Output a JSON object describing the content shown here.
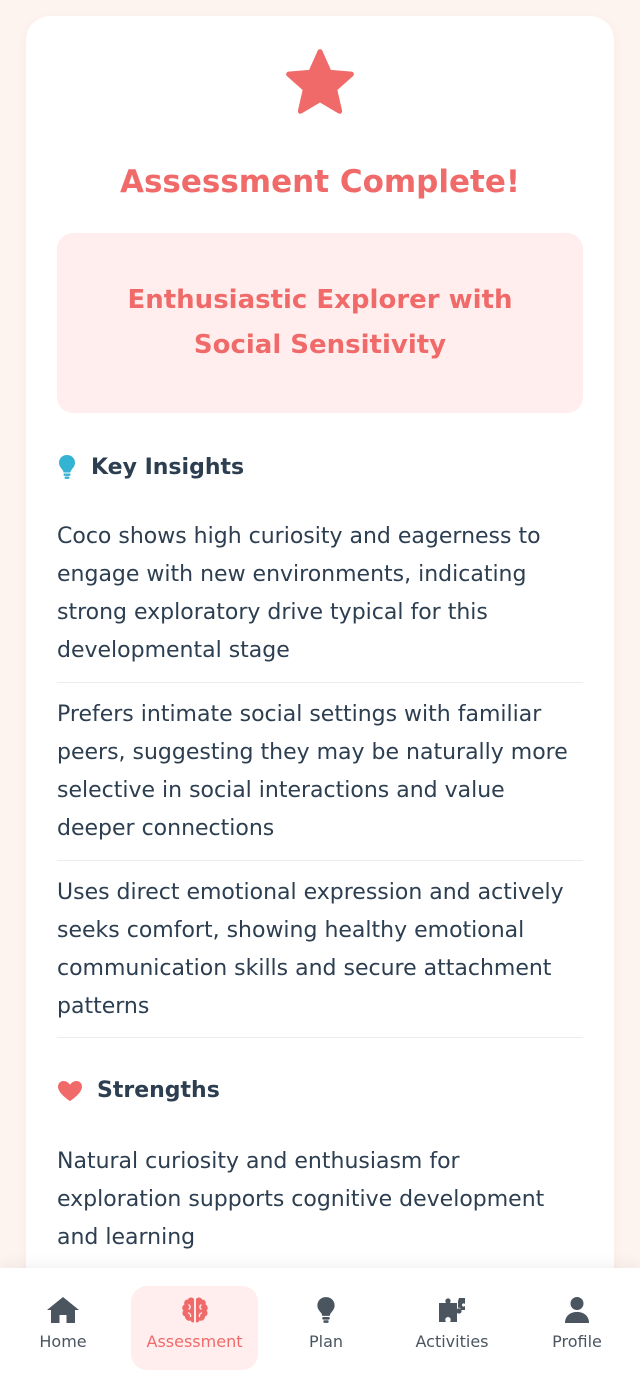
{
  "header": {
    "title": "Assessment Complete!",
    "icon": "star-icon"
  },
  "profile": {
    "type": "Enthusiastic Explorer with Social Sensitivity"
  },
  "key_insights": {
    "heading": "Key Insights",
    "icon": "lightbulb-icon",
    "items": [
      "Coco shows high curiosity and eagerness to engage with new environments, indicating strong exploratory drive typical for this developmental stage",
      "Prefers intimate social settings with familiar peers, suggesting they may be naturally more selective in social interactions and value deeper connections",
      "Uses direct emotional expression and actively seeks comfort, showing healthy emotional communication skills and secure attachment patterns"
    ]
  },
  "strengths": {
    "heading": "Strengths",
    "icon": "heart-icon",
    "items": [
      "Natural curiosity and enthusiasm for exploration supports cognitive development and learning"
    ]
  },
  "nav": {
    "items": [
      {
        "label": "Home",
        "icon": "home-icon"
      },
      {
        "label": "Assessment",
        "icon": "brain-icon"
      },
      {
        "label": "Plan",
        "icon": "lightbulb-icon"
      },
      {
        "label": "Activities",
        "icon": "puzzle-icon"
      },
      {
        "label": "Profile",
        "icon": "user-icon"
      }
    ],
    "active": "Assessment"
  },
  "colors": {
    "accent": "#f06a6a",
    "accent_soft": "#ffeeed",
    "text": "#2c3e50",
    "insight_icon": "#35b3d3",
    "nav_icon": "#4a5560"
  }
}
